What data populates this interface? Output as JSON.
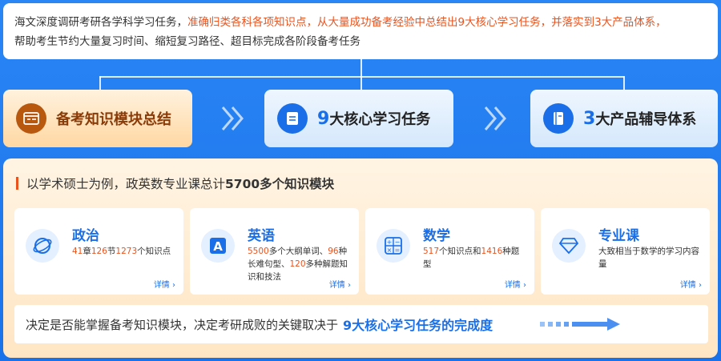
{
  "intro": {
    "line1_plain": "海文深度调研考研各学科学习任务，",
    "line1_highlight": "准确归类各科各项知识点，从大量成功备考经验中总结出9大核心学习任务，并落实到3大产品体系，",
    "line2": "帮助考生节约大量复习时间、缩短复习路径、超目标完成各阶段备考任务"
  },
  "steps": [
    {
      "label": "备考知识模块总结",
      "icon": "card-icon"
    },
    {
      "prefix": "9",
      "label": "大核心学习任务",
      "icon": "document-icon"
    },
    {
      "prefix": "3",
      "label": "大产品辅导体系",
      "icon": "notebook-icon"
    }
  ],
  "panel": {
    "title_pre": "以学术硕士为例，政英数专业课总计",
    "title_bold": "5700多个知识模块",
    "subjects": [
      {
        "name": "政治",
        "icon": "orbit-icon",
        "parts": [
          {
            "t": "41",
            "n": true
          },
          {
            "t": "章",
            "n": false
          },
          {
            "t": "126",
            "n": true
          },
          {
            "t": "节",
            "n": false
          },
          {
            "t": "1273",
            "n": true
          },
          {
            "t": "个知识点",
            "n": false
          }
        ],
        "more": "详情 ›"
      },
      {
        "name": "英语",
        "icon": "letter-a-icon",
        "parts": [
          {
            "t": "5500",
            "n": true
          },
          {
            "t": "多个大纲单词、",
            "n": false
          },
          {
            "t": "96",
            "n": true
          },
          {
            "t": "种长难句型、",
            "n": false
          },
          {
            "t": "120",
            "n": true
          },
          {
            "t": "多种解题知识和技法",
            "n": false
          }
        ],
        "more": "详情 ›"
      },
      {
        "name": "数学",
        "icon": "calculator-icon",
        "parts": [
          {
            "t": "517",
            "n": true
          },
          {
            "t": "个知识点和",
            "n": false
          },
          {
            "t": "1416",
            "n": true
          },
          {
            "t": "种题型",
            "n": false
          }
        ],
        "more": "详情 ›"
      },
      {
        "name": "专业课",
        "icon": "diamond-icon",
        "parts": [
          {
            "t": "大致相当于数学的学习内容量",
            "n": false
          }
        ],
        "more": "详情 ›"
      }
    ],
    "bottom_plain": "决定是否能掌握备考知识模块，决定考研成败的关键取决于",
    "bottom_blue": "9大核心学习任务的完成度"
  }
}
